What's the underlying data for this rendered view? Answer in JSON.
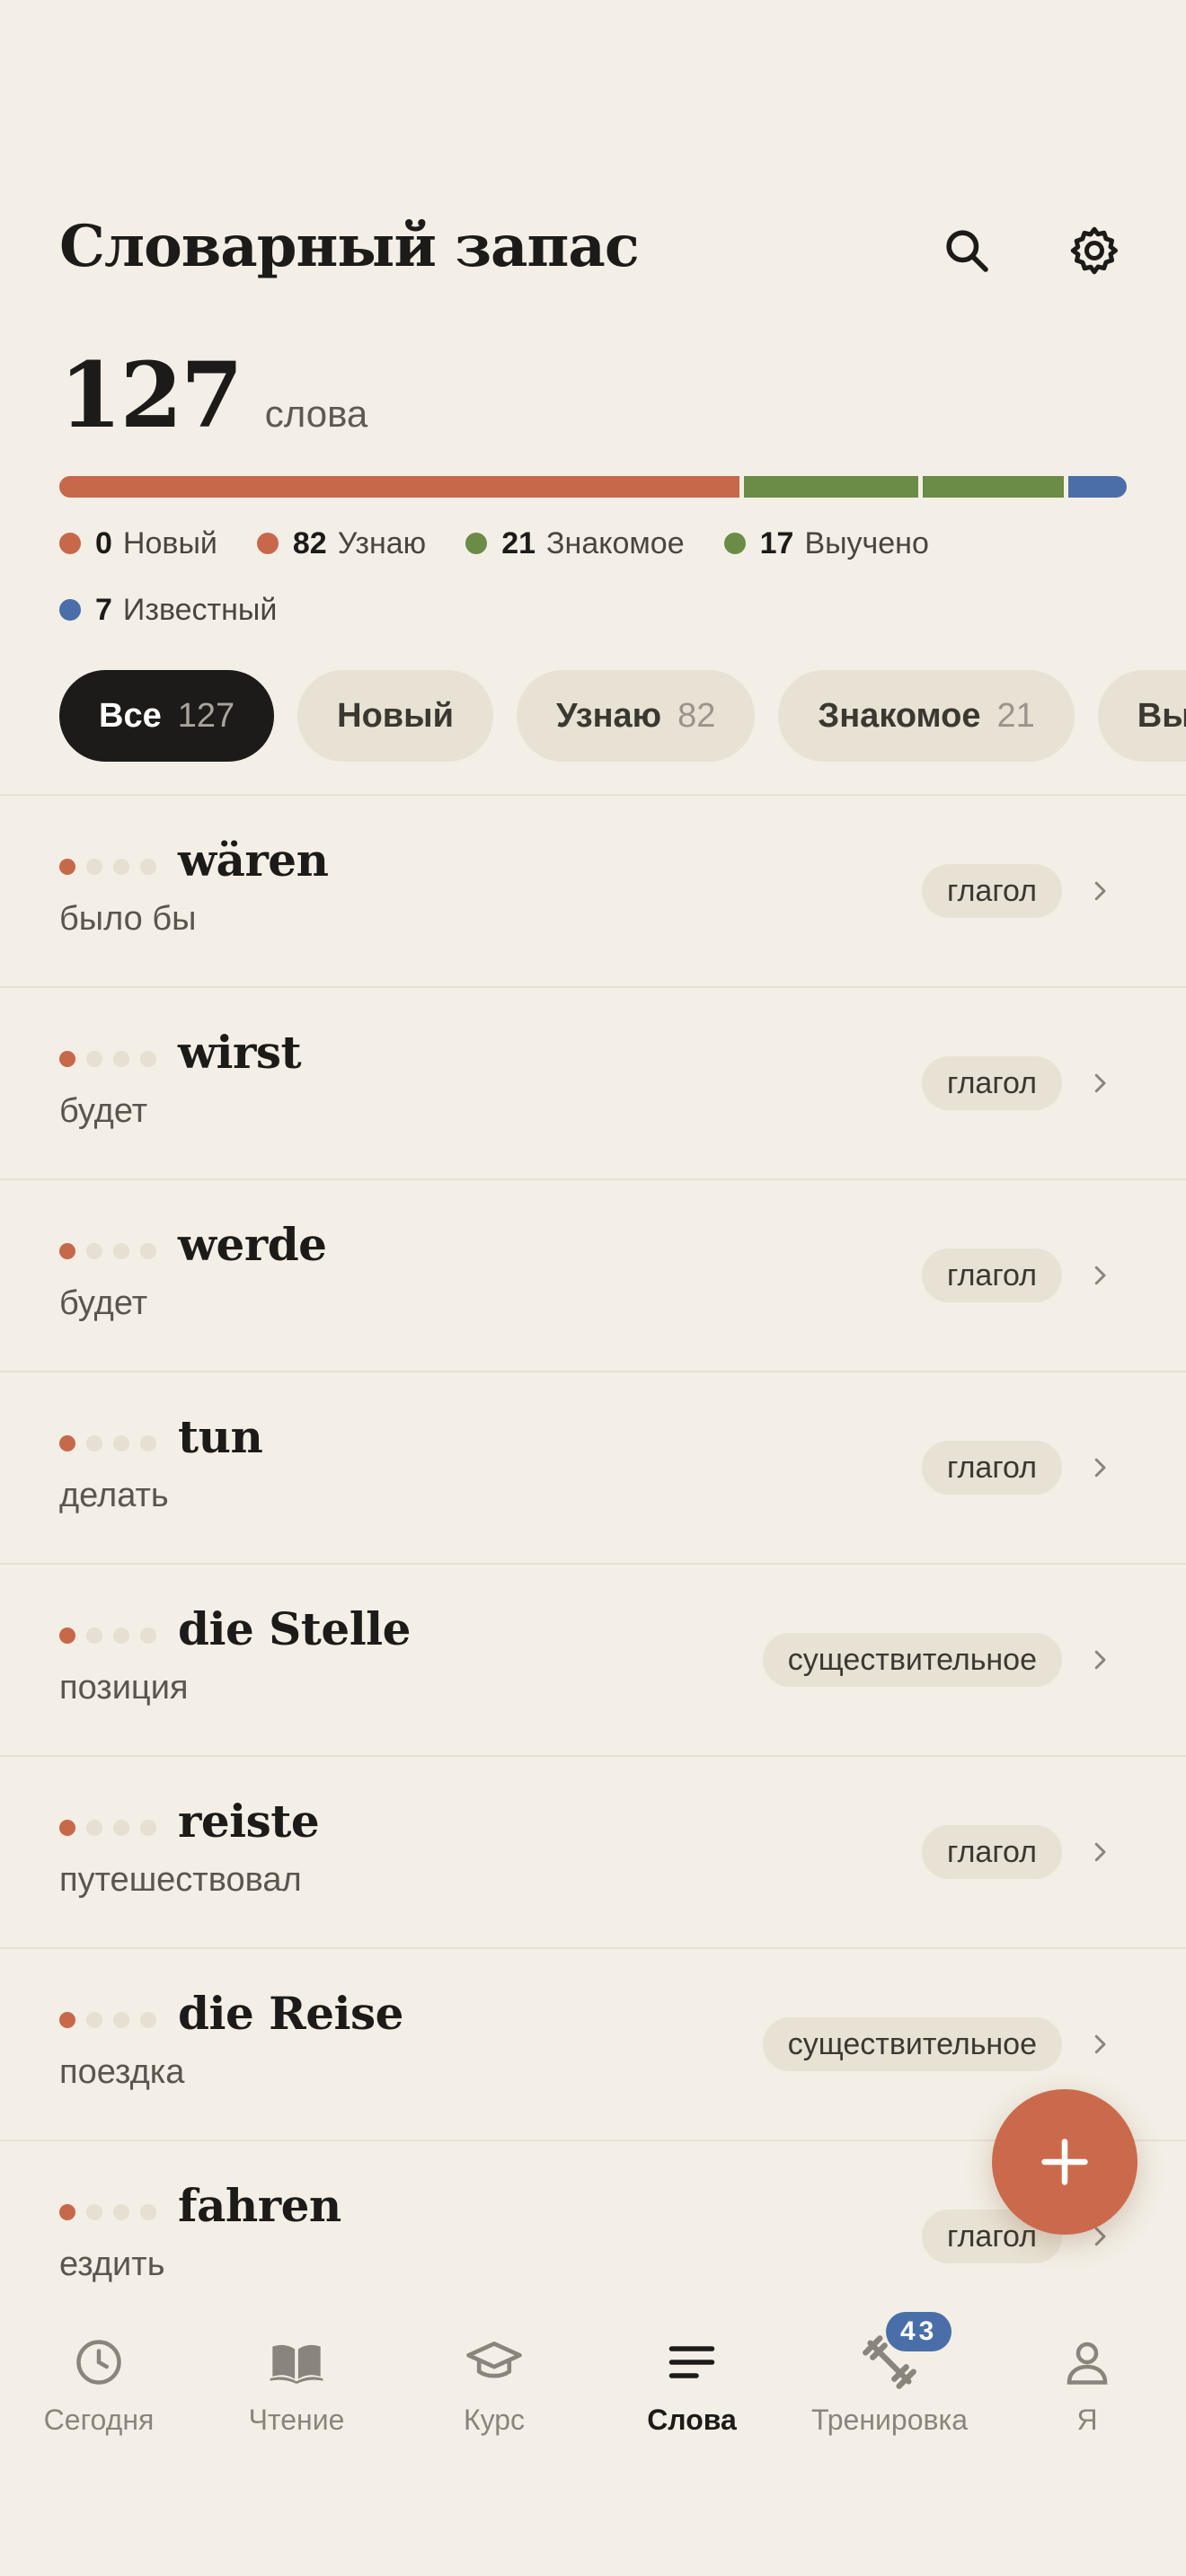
{
  "header": {
    "title": "Словарный запас"
  },
  "summary": {
    "count": "127",
    "unit": "слова"
  },
  "progress": {
    "segments": [
      {
        "name": "Узнаю",
        "value": 82,
        "color": "#c8684a"
      },
      {
        "name": "Знакомое",
        "value": 21,
        "color": "#6a8c46"
      },
      {
        "name": "Выучено",
        "value": 17,
        "color": "#6a8c46"
      },
      {
        "name": "Известный",
        "value": 7,
        "color": "#4a6fa8"
      }
    ]
  },
  "legend": [
    {
      "count": "0",
      "label": "Новый",
      "color": "#c8684a"
    },
    {
      "count": "82",
      "label": "Узнаю",
      "color": "#c8684a"
    },
    {
      "count": "21",
      "label": "Знакомое",
      "color": "#6a8c46"
    },
    {
      "count": "17",
      "label": "Выучено",
      "color": "#6a8c46"
    },
    {
      "count": "7",
      "label": "Известный",
      "color": "#4a6fa8"
    }
  ],
  "filters": [
    {
      "label": "Все",
      "count": "127",
      "active": true
    },
    {
      "label": "Новый",
      "count": "",
      "active": false
    },
    {
      "label": "Узнаю",
      "count": "82",
      "active": false
    },
    {
      "label": "Знакомое",
      "count": "21",
      "active": false
    },
    {
      "label": "Вы",
      "count": "",
      "active": false
    }
  ],
  "words": [
    {
      "word": "wären",
      "translation": "было бы",
      "pos": "глагол",
      "level": 1
    },
    {
      "word": "wirst",
      "translation": "будет",
      "pos": "глагол",
      "level": 1
    },
    {
      "word": "werde",
      "translation": "будет",
      "pos": "глагол",
      "level": 1
    },
    {
      "word": "tun",
      "translation": "делать",
      "pos": "глагол",
      "level": 1
    },
    {
      "word": "die Stelle",
      "translation": "позиция",
      "pos": "существительное",
      "level": 1
    },
    {
      "word": "reiste",
      "translation": "путешествовал",
      "pos": "глагол",
      "level": 1
    },
    {
      "word": "die Reise",
      "translation": "поездка",
      "pos": "существительное",
      "level": 1
    },
    {
      "word": "fahren",
      "translation": "ездить",
      "pos": "глагол",
      "level": 1
    }
  ],
  "fab": {
    "icon": "plus-icon"
  },
  "tabs": [
    {
      "label": "Сегодня",
      "icon": "clock-icon",
      "active": false
    },
    {
      "label": "Чтение",
      "icon": "book-icon",
      "active": false
    },
    {
      "label": "Курс",
      "icon": "graduation-cap-icon",
      "active": false
    },
    {
      "label": "Слова",
      "icon": "lines-icon",
      "active": true
    },
    {
      "label": "Тренировка",
      "icon": "dumbbell-icon",
      "active": false,
      "badge": "43"
    },
    {
      "label": "Я",
      "icon": "person-icon",
      "active": false
    }
  ],
  "colors": {
    "accent": "#cb6a4b",
    "background": "#f3efe6",
    "chip": "#e8e2d4",
    "known": "#4a6fa8",
    "familiar": "#6a8c46"
  }
}
